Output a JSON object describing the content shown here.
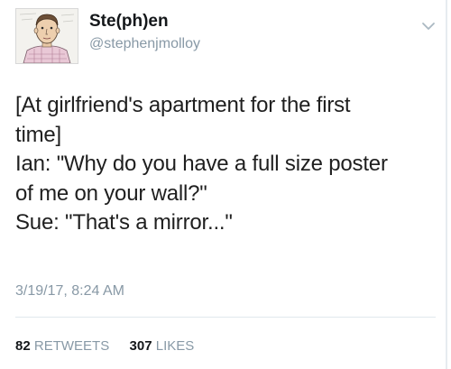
{
  "tweet": {
    "author": {
      "display_name": "Ste(ph)en",
      "handle": "@stephenjmolloy"
    },
    "text_lines": [
      "[At girlfriend's apartment for the first",
      "time]",
      "Ian: \"Why do you have a full size poster",
      "of me on your wall?\"",
      "Sue: \"That's a mirror...\""
    ],
    "timestamp": "3/19/17, 8:24 AM",
    "retweets": {
      "count": "82",
      "label": "RETWEETS"
    },
    "likes": {
      "count": "307",
      "label": "LIKES"
    }
  },
  "icons": {
    "menu": "chevron-down-icon"
  },
  "colors": {
    "primary_text": "#14171a",
    "secondary_text": "#8899a6",
    "divider": "#e1e8ed"
  }
}
